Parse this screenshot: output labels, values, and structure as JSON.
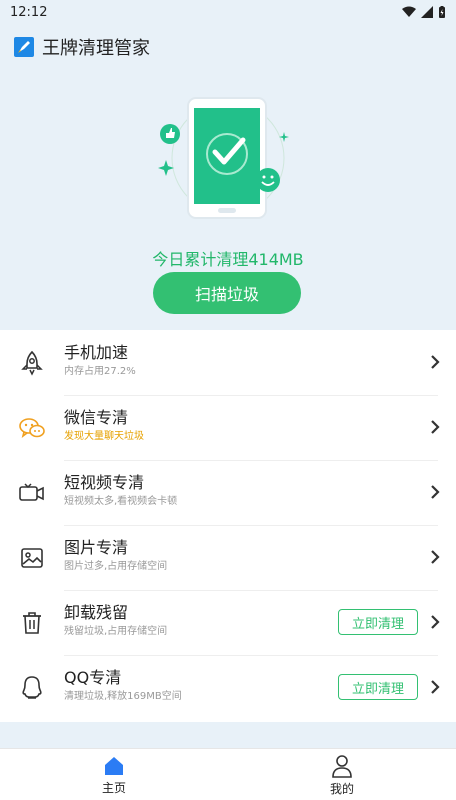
{
  "status": {
    "time": "12:12"
  },
  "app": {
    "title": "王牌清理管家"
  },
  "hero": {
    "today_text": "今日累计清理414MB",
    "scan_button": "扫描垃圾"
  },
  "features": [
    {
      "title": "手机加速",
      "subtitle": "内存占用27.2%",
      "icon": "rocket-icon",
      "action": ""
    },
    {
      "title": "微信专清",
      "subtitle": "发现大量聊天垃圾",
      "icon": "wechat-icon",
      "action": ""
    },
    {
      "title": "短视频专清",
      "subtitle": "短视频太多,看视频会卡顿",
      "icon": "video-camera-icon",
      "action": ""
    },
    {
      "title": "图片专清",
      "subtitle": "图片过多,占用存储空间",
      "icon": "image-icon",
      "action": ""
    },
    {
      "title": "卸载残留",
      "subtitle": "残留垃圾,占用存储空间",
      "icon": "trash-icon",
      "action": "立即清理"
    },
    {
      "title": "QQ专清",
      "subtitle": "清理垃圾,释放169MB空间",
      "icon": "qq-icon",
      "action": "立即清理"
    }
  ],
  "nav": {
    "home": "主页",
    "mine": "我的"
  },
  "colors": {
    "accent": "#33c072",
    "warning": "#e6a100",
    "background": "#e8f1f8"
  }
}
